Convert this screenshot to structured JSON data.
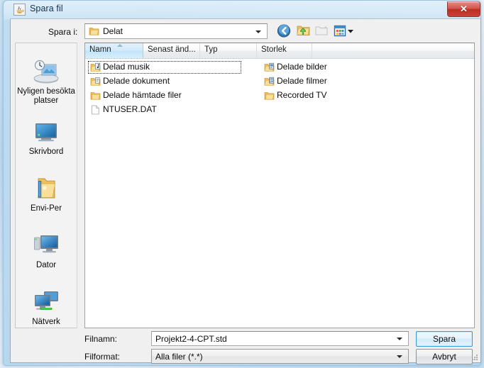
{
  "window": {
    "title": "Spara fil",
    "title_icon": "java-cup-icon",
    "close_label": "✕"
  },
  "toolbar": {
    "look_in_label": "Spara i:",
    "look_in_value": "Delat",
    "look_in_icon": "folder-icon",
    "buttons": [
      {
        "name": "back-button",
        "icon": "back-arrow-icon",
        "enabled": true
      },
      {
        "name": "up-one-level-button",
        "icon": "up-folder-icon",
        "enabled": true
      },
      {
        "name": "new-folder-button",
        "icon": "new-folder-icon",
        "enabled": false
      },
      {
        "name": "views-button",
        "icon": "views-icon",
        "enabled": true
      }
    ]
  },
  "places_bar": {
    "items": [
      {
        "label_line1": "Nyligen besökta",
        "label_line2": "platser",
        "icon": "recent-places-icon"
      },
      {
        "label_line1": "Skrivbord",
        "label_line2": "",
        "icon": "desktop-icon"
      },
      {
        "label_line1": "Envi-Per",
        "label_line2": "",
        "icon": "user-folder-icon"
      },
      {
        "label_line1": "Dator",
        "label_line2": "",
        "icon": "computer-icon"
      },
      {
        "label_line1": "Nätverk",
        "label_line2": "",
        "icon": "network-icon"
      }
    ]
  },
  "file_list": {
    "columns": [
      {
        "label": "Namn",
        "sorted": true,
        "sort_direction": "asc"
      },
      {
        "label": "Senast änd...",
        "sorted": false
      },
      {
        "label": "Typ",
        "sorted": false
      },
      {
        "label": "Storlek",
        "sorted": false
      }
    ],
    "items": [
      {
        "label": "Delad musik",
        "icon": "shared-music-folder-icon",
        "focused": true,
        "column": 1
      },
      {
        "label": "Delade dokument",
        "icon": "shared-documents-folder-icon",
        "focused": false,
        "column": 1
      },
      {
        "label": "Delade hämtade filer",
        "icon": "folder-icon",
        "focused": false,
        "column": 1
      },
      {
        "label": "NTUSER.DAT",
        "icon": "generic-file-icon",
        "focused": false,
        "column": 1
      },
      {
        "label": "Delade bilder",
        "icon": "shared-pictures-folder-icon",
        "focused": false,
        "column": 2
      },
      {
        "label": "Delade filmer",
        "icon": "shared-videos-folder-icon",
        "focused": false,
        "column": 2
      },
      {
        "label": "Recorded TV",
        "icon": "folder-icon",
        "focused": false,
        "column": 2
      }
    ]
  },
  "bottom": {
    "filename_label": "Filnamn:",
    "filename_value": "Projekt2-4-CPT.std",
    "filetype_label": "Filformat:",
    "filetype_value": "Alla filer (*.*)",
    "save_button": "Spara",
    "cancel_button": "Avbryt"
  },
  "colors": {
    "accent_blue": "#3c9ad9",
    "close_red": "#bc2f24",
    "folder_yellow": "#f5cd6b",
    "sorted_header": "#d2eafa"
  }
}
